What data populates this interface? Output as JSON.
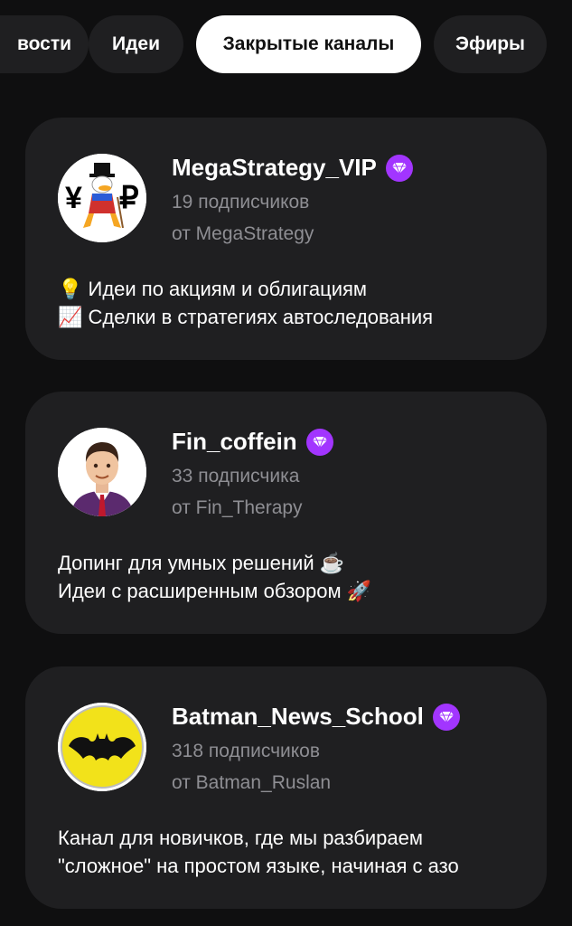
{
  "tabs": [
    {
      "label": "вости",
      "active": false
    },
    {
      "label": "Идеи",
      "active": false
    },
    {
      "label": "Закрытые каналы",
      "active": true
    },
    {
      "label": "Эфиры",
      "active": false
    }
  ],
  "channels": [
    {
      "name": "MegaStrategy_VIP",
      "subscribers": "19 подписчиков",
      "author": "от MegaStrategy",
      "description": [
        "💡 Идеи по акциям и облигациям",
        "📈 Сделки в стратегиях автоследования"
      ],
      "avatar_icon": "duck-money-icon",
      "avatar_text": [
        "¥",
        "₽"
      ]
    },
    {
      "name": "Fin_coffein",
      "subscribers": "33 подписчика",
      "author": "от Fin_Therapy",
      "description": [
        "Допинг для умных решений ☕",
        "Идеи с расширенным обзором 🚀"
      ],
      "avatar_icon": "man-portrait-icon"
    },
    {
      "name": "Batman_News_School",
      "subscribers": "318 подписчиков",
      "author": "от Batman_Ruslan",
      "description": [
        "Канал для новичков, где мы разбираем",
        "\"сложное\" на простом языке, начиная с азо"
      ],
      "avatar_icon": "batman-logo-icon"
    }
  ],
  "colors": {
    "background": "#0f0f10",
    "card": "#1f1f21",
    "badge": "#a235ff",
    "muted_text": "#8e8e93"
  }
}
